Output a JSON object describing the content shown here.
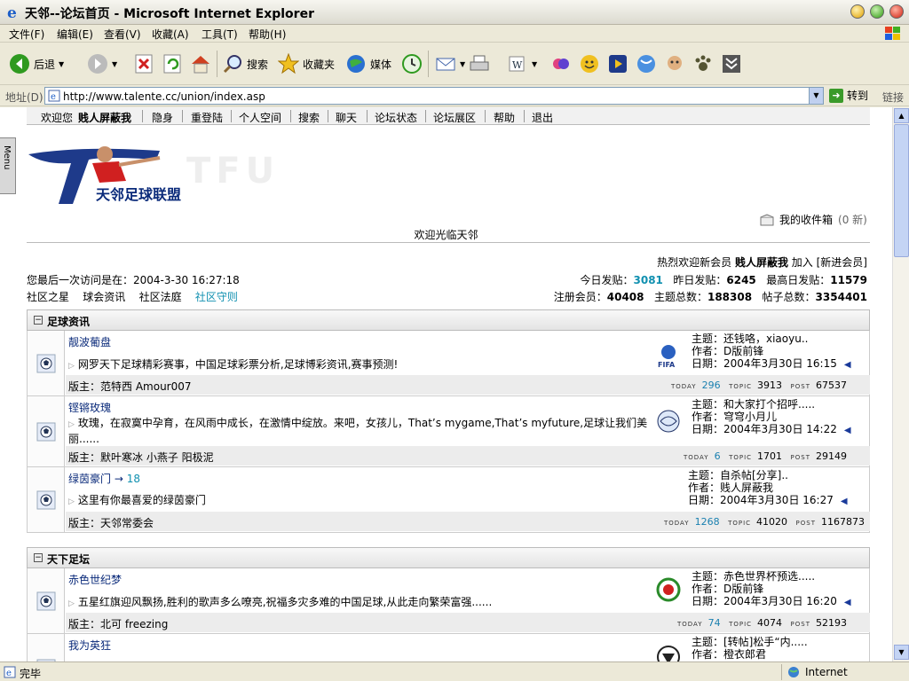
{
  "window": {
    "title": "天邻--论坛首页 - Microsoft Internet Explorer"
  },
  "menu": [
    "文件(F)",
    "编辑(E)",
    "查看(V)",
    "收藏(A)",
    "工具(T)",
    "帮助(H)"
  ],
  "toolbar": {
    "back": "后退",
    "search": "搜索",
    "favorites": "收藏夹",
    "media": "媒体"
  },
  "address": {
    "label": "地址(D)",
    "url": "http://www.talente.cc/union/index.asp",
    "go": "转到",
    "links": "链接"
  },
  "nav": [
    "欢迎您",
    "贱人屏蔽我",
    "隐身",
    "重登陆",
    "个人空间",
    "搜索",
    "聊天",
    "论坛状态",
    "论坛展区",
    "帮助",
    "退出"
  ],
  "menu_tab": "Menu",
  "logo": {
    "text": "天邻足球联盟",
    "watermark": "TFU"
  },
  "inbox": {
    "label": "我的收件箱",
    "count": "(0 新)"
  },
  "welcome": "欢迎光临天邻",
  "info": {
    "new_member_prefix": "热烈欢迎新会员",
    "new_member_name": "贱人屏蔽我",
    "join": "加入",
    "new_member_link": "[新进会员]",
    "last_visit": "您最后一次访问是在：2004-3-30 16:27:18",
    "today_label": "今日发贴：",
    "today": "3081",
    "yesterday_label": "昨日发贴：",
    "yesterday": "6245",
    "max_label": "最高日发贴：",
    "max": "11579",
    "links": [
      "社区之星",
      "球会资讯",
      "社区法庭",
      "社区守则"
    ],
    "members_label": "注册会员：",
    "members": "40408",
    "topics_label": "主题总数：",
    "topics": "188308",
    "posts_label": "帖子总数：",
    "posts": "3354401"
  },
  "categories": [
    {
      "title": "足球资讯",
      "forums": [
        {
          "name": "靓波葡盘",
          "desc": "网罗天下足球精彩赛事，中国足球彩票分析,足球博彩资讯,赛事预测!",
          "mods_label": "版主：",
          "mods": "范特西 Amour007",
          "today": "296",
          "topic": "3913",
          "post": "67537",
          "last_topic": "主题：还钱咯，xiaoyu..",
          "last_author": "作者：D版前锋",
          "last_date": "日期：2004年3月30日 16:15"
        },
        {
          "name": "铿锵玫瑰",
          "desc": "玫瑰，在寂寞中孕育，在风雨中成长，在激情中绽放。来吧，女孩儿，That’s mygame,That’s myfuture,足球让我们美丽......",
          "mods_label": "版主：",
          "mods": "默叶寒冰 小燕子 阳极泥",
          "today": "6",
          "topic": "1701",
          "post": "29149",
          "last_topic": "主题：和大家打个招呼.....",
          "last_author": "作者：穹穹小月儿",
          "last_date": "日期：2004年3月30日 14:22"
        },
        {
          "name": "绿茵豪门",
          "sub_arrow": "→",
          "sub_count": "18",
          "desc": "这里有你最喜爱的绿茵豪门",
          "mods_label": "版主：",
          "mods": "天邻常委会",
          "today": "1268",
          "topic": "41020",
          "post": "1167873",
          "last_topic": "主题：自杀帖[分享]..",
          "last_author": "作者：贱人屏蔽我",
          "last_date": "日期：2004年3月30日 16:27"
        }
      ]
    },
    {
      "title": "天下足坛",
      "forums": [
        {
          "name": "赤色世纪梦",
          "desc": "五星红旗迎风飘扬,胜利的歌声多么嘹亮,祝福多灾多难的中国足球,从此走向繁荣富强......",
          "mods_label": "版主：",
          "mods": "北可 freezing",
          "today": "74",
          "topic": "4074",
          "post": "52193",
          "last_topic": "主题：赤色世界杯预选.....",
          "last_author": "作者：D版前锋",
          "last_date": "日期：2004年3月30日 16:20"
        },
        {
          "name": "我为英狂",
          "last_topic": "主题：[转帖]松手“内.....",
          "last_author": "作者：橙衣郎君"
        }
      ]
    }
  ],
  "stat_labels": {
    "today": "TODAY",
    "topic": "TOPIC",
    "post": "POST"
  },
  "fifa_label": "FIFA",
  "status": {
    "text": "完毕",
    "zone": "Internet"
  },
  "colors": {
    "accent": "#1a6ad0",
    "link_dark": "#0a2a7a",
    "stat_num": "#1a80b0"
  },
  "icons": [
    "ie-logo-icon",
    "back-icon",
    "forward-icon",
    "stop-icon",
    "refresh-icon",
    "home-icon",
    "search-icon",
    "favorites-icon",
    "media-icon",
    "history-icon",
    "mail-icon",
    "print-icon",
    "edit-icon",
    "messenger-icon",
    "qq-icon",
    "realplayer-icon",
    "globe-icon",
    "soccer-ball-icon",
    "inbox-icon"
  ]
}
